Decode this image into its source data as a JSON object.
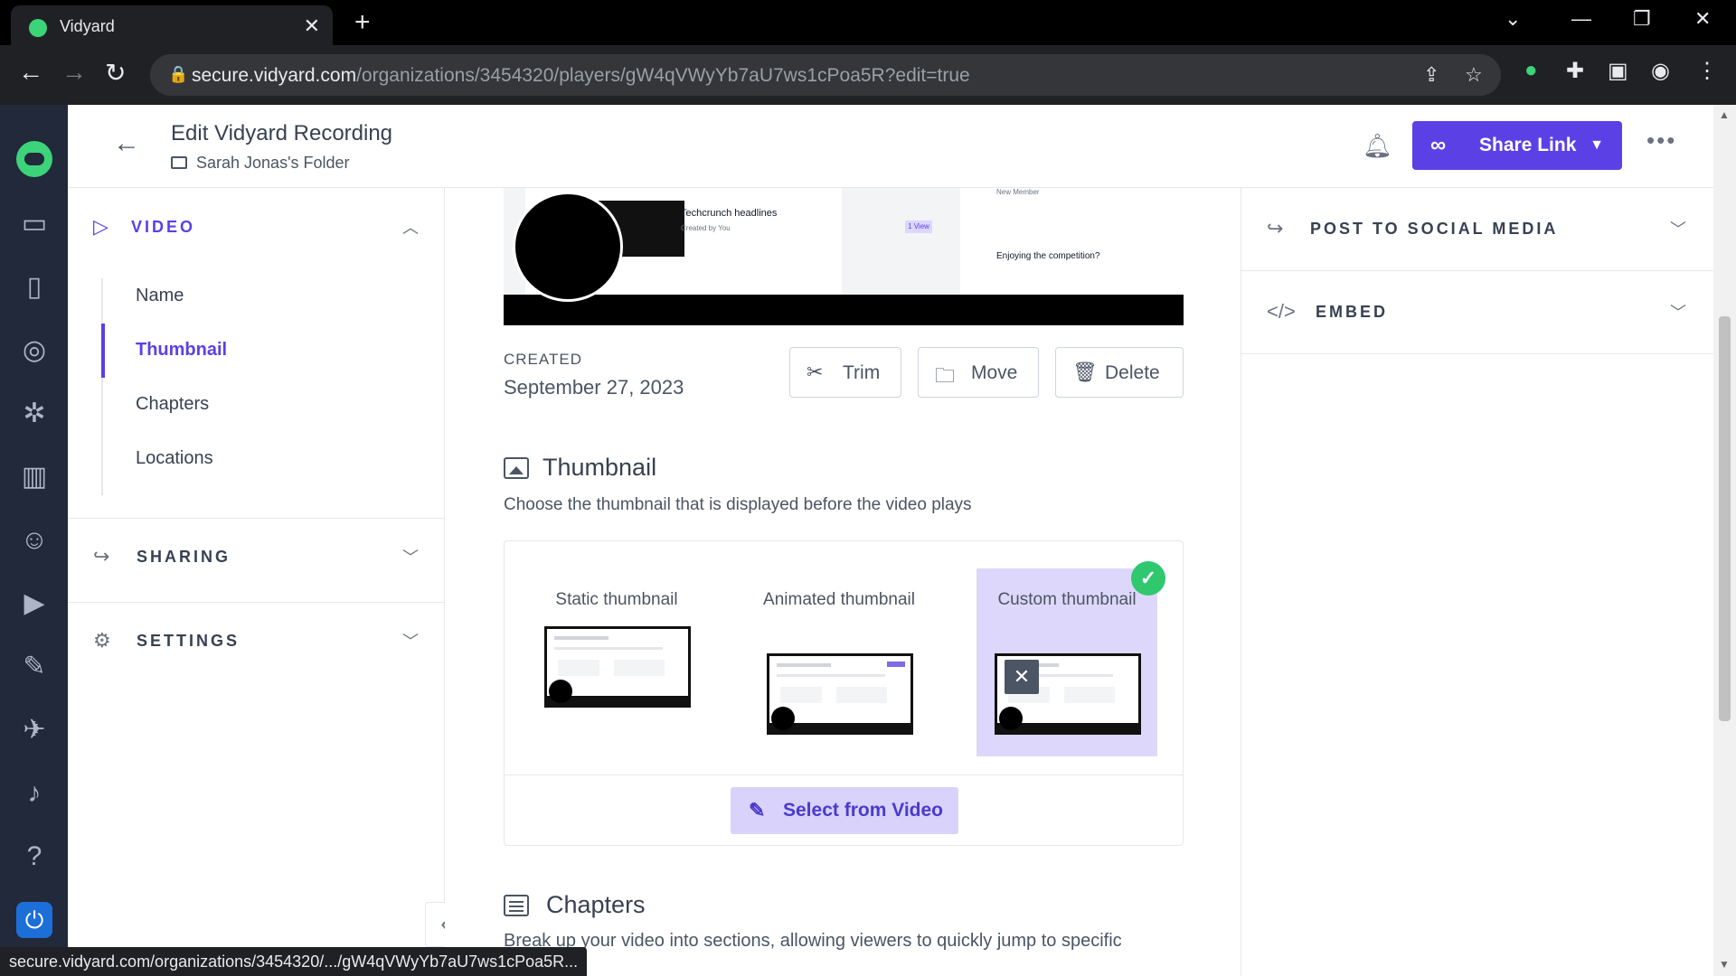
{
  "browser": {
    "tab_title": "Vidyard",
    "tab_close": "✕",
    "new_tab": "+",
    "url_host": "secure.vidyard.com",
    "url_path": "/organizations/3454320/players/gW4qVWyYb7aU7ws1cPoa5R?edit=true",
    "status_url": "secure.vidyard.com/organizations/3454320/.../gW4qVWyYb7aU7ws1cPoa5R..."
  },
  "header": {
    "title": "Edit Vidyard Recording",
    "folder": "Sarah Jonas's Folder",
    "share_label": "Share Link"
  },
  "left_panel": {
    "video": {
      "label": "VIDEO",
      "items": [
        {
          "label": "Name"
        },
        {
          "label": "Thumbnail"
        },
        {
          "label": "Chapters"
        },
        {
          "label": "Locations"
        }
      ]
    },
    "sharing": {
      "label": "SHARING"
    },
    "settings": {
      "label": "SETTINGS"
    }
  },
  "preview": {
    "card_title": "Techcrunch headlines",
    "card_sub": "Created by You",
    "chip": "1 View",
    "member_label": "New Member",
    "competition": "Enjoying the competition?"
  },
  "main": {
    "created_label": "CREATED",
    "created_date": "September 27, 2023",
    "trim_label": "Trim",
    "move_label": "Move",
    "delete_label": "Delete",
    "thumbnail_heading": "Thumbnail",
    "thumbnail_desc": "Choose the thumbnail that is displayed before the video plays",
    "options": {
      "static": "Static thumbnail",
      "animated": "Animated thumbnail",
      "custom": "Custom thumbnail"
    },
    "select_label": "Select from Video",
    "chapters_heading": "Chapters",
    "chapters_desc": "Break up your video into sections, allowing viewers to quickly jump to specific"
  },
  "right_panel": {
    "social_label": "POST TO SOCIAL MEDIA",
    "embed_label": "EMBED"
  },
  "colors": {
    "accent": "#5b40e6",
    "rail": "#21293a",
    "success": "#2fc86f"
  }
}
